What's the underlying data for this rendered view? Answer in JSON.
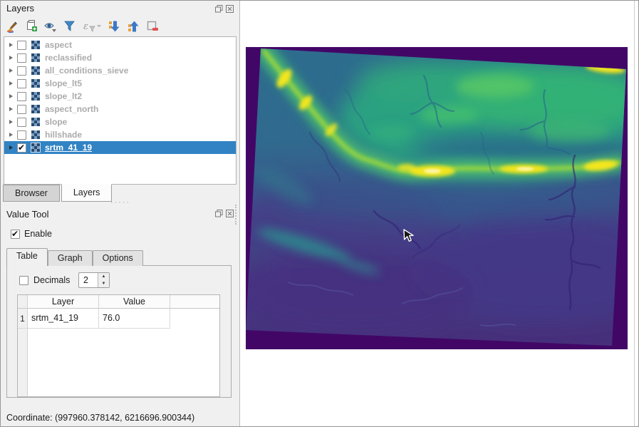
{
  "layers_panel": {
    "title": "Layers",
    "toolbar_icons": [
      {
        "icon": "styling-brush-icon"
      },
      {
        "icon": "add-group-icon"
      },
      {
        "icon": "map-themes-eye-icon"
      },
      {
        "icon": "filter-legend-icon"
      },
      {
        "icon": "expression-filter-icon"
      },
      {
        "icon": "expand-all-icon"
      },
      {
        "icon": "collapse-all-icon"
      },
      {
        "icon": "remove-layer-icon"
      }
    ],
    "layers": [
      {
        "name": "aspect",
        "checked": false,
        "selected": false
      },
      {
        "name": "reclassified",
        "checked": false,
        "selected": false
      },
      {
        "name": "all_conditions_sieve",
        "checked": false,
        "selected": false
      },
      {
        "name": "slope_lt5",
        "checked": false,
        "selected": false
      },
      {
        "name": "slope_lt2",
        "checked": false,
        "selected": false
      },
      {
        "name": "aspect_north",
        "checked": false,
        "selected": false
      },
      {
        "name": "slope",
        "checked": false,
        "selected": false
      },
      {
        "name": "hillshade",
        "checked": false,
        "selected": false
      },
      {
        "name": "srtm_41_19",
        "checked": true,
        "selected": true
      }
    ],
    "bottom_tabs": {
      "browser": "Browser",
      "layers": "Layers",
      "active": "Layers"
    }
  },
  "value_tool": {
    "title": "Value Tool",
    "enable": {
      "label": "Enable",
      "checked": true
    },
    "tabs": {
      "table": "Table",
      "graph": "Graph",
      "options": "Options",
      "active": "Table"
    },
    "decimals": {
      "label": "Decimals",
      "checked": false,
      "value": "2"
    },
    "table": {
      "headers": {
        "layer": "Layer",
        "value": "Value"
      },
      "rows": [
        {
          "index": "1",
          "layer": "srtm_41_19",
          "value": "76.0"
        }
      ]
    }
  },
  "statusbar": {
    "coordinate": "Coordinate: (997960.378142, 6216696.900344)"
  },
  "map": {
    "layer_shown": "srtm_41_19",
    "colors": {
      "nodata_purple": "#420766",
      "low_elev": "#46327e",
      "mid_elev": "#31688e",
      "high_elev": "#35b779",
      "ridge_yellow": "#f4e61f",
      "selection_blue": "#3183c4"
    }
  }
}
